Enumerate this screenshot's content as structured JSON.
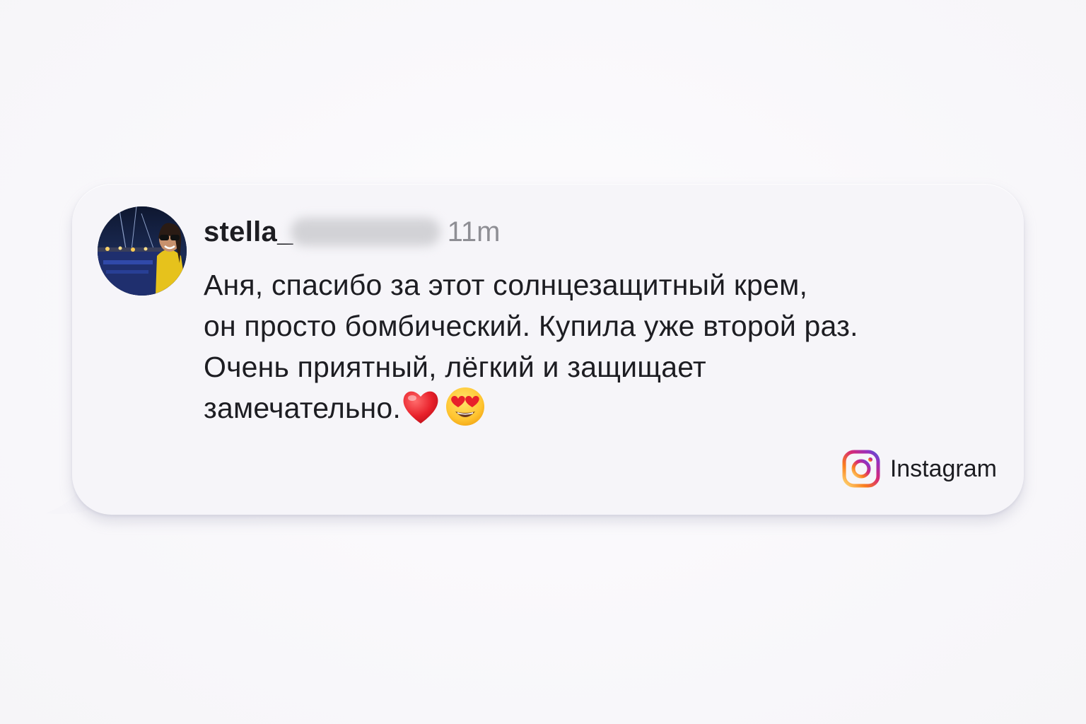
{
  "comment": {
    "username": "stella_",
    "username_redacted": true,
    "time": "11m",
    "lines": [
      "Аня, спасибо за этот солнцезащитный крем,",
      "он просто бомбический. Купила уже второй раз.",
      "Очень приятный, лёгкий и защищает",
      "замечательно."
    ],
    "emojis": [
      "heart-emoji",
      "heart-eyes-emoji"
    ]
  },
  "brand": {
    "label": "Instagram",
    "icon": "instagram-icon"
  },
  "colors": {
    "background": "#fbfafc",
    "bubble": "#f6f5f9",
    "text": "#1d1d22",
    "time": "#8e8e94",
    "instagram_gradient": [
      "#feda75",
      "#fa7e1e",
      "#d62976",
      "#962fbf",
      "#4f5bd5"
    ]
  }
}
